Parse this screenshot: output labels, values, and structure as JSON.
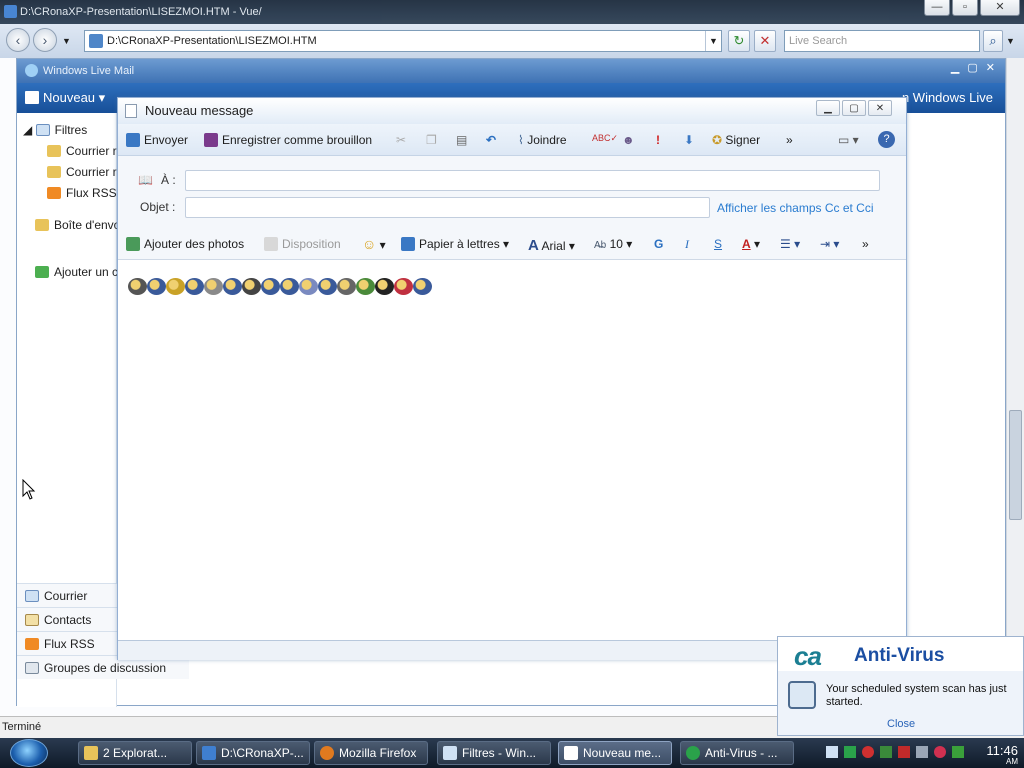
{
  "ie": {
    "window_title": "D:\\CRonaXP-Presentation\\LISEZMOI.HTM - Vue/",
    "address": "D:\\CRonaXP-Presentation\\LISEZMOI.HTM",
    "search_placeholder": "Live Search",
    "status": "Terminé"
  },
  "wlm": {
    "window_title": "Windows Live Mail",
    "toolbar_new": "Nouveau",
    "toolbar_right": "n Windows Live",
    "sidebar": {
      "filtres": "Filtres",
      "courrier1": "Courrier r",
      "courrier2": "Courrier r",
      "flux": "Flux RSS",
      "boite": "Boîte d'envo",
      "ajouter": "Ajouter un c"
    },
    "bottom_nav": [
      "Courrier",
      "Contacts",
      "Flux RSS",
      "Groupes de discussion"
    ]
  },
  "compose": {
    "title": "Nouveau message",
    "toolbar": {
      "send": "Envoyer",
      "save_draft": "Enregistrer comme brouillon",
      "attach": "Joindre",
      "sign": "Signer",
      "more": "»"
    },
    "fields": {
      "to_label": "À :",
      "subject_label": "Objet :",
      "cc_link": "Afficher les champs Cc et Cci"
    },
    "format_bar": {
      "add_photos": "Ajouter des photos",
      "layout": "Disposition",
      "stationery": "Papier à lettres",
      "font": "Arial",
      "size": "10",
      "bold": "G",
      "italic": "I",
      "underline": "S",
      "font_color": "A",
      "more": "»"
    },
    "emoticons": [
      "sheep",
      "person",
      "cat-face",
      "person",
      "plane",
      "person",
      "cat",
      "person",
      "person",
      "moon",
      "person",
      "camera",
      "turtle",
      "umbrella",
      "car",
      "person"
    ]
  },
  "notification": {
    "logo": "ca",
    "brand": "Anti-Virus",
    "message": "Your scheduled system scan has just started.",
    "close": "Close"
  },
  "taskbar": {
    "tasks": [
      "2 Explorat...",
      "D:\\CRonaXP-...",
      "Mozilla Firefox",
      "Filtres - Win...",
      "Nouveau me...",
      "Anti-Virus - ..."
    ],
    "clock_time": "11:46",
    "clock_ampm": "AM"
  },
  "colors": {
    "accent": "#2e6fbd",
    "link": "#2a7cd0",
    "brand": "#1b4ea2"
  }
}
